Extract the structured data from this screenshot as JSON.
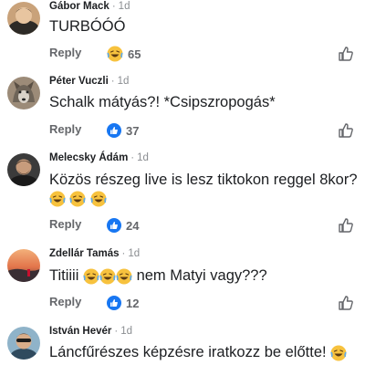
{
  "comments": [
    {
      "name": "Gábor Mack",
      "time": "1d",
      "text": "TURBÓÓÓ",
      "reply": "Reply",
      "reaction": "haha-emoji",
      "count": "65"
    },
    {
      "name": "Péter Vuczli",
      "time": "1d",
      "text": "Schalk mátyás?! *Csipszropogás*",
      "reply": "Reply",
      "reaction": "like-icon",
      "count": "37"
    },
    {
      "name": "Melecsky Ádám",
      "time": "1d",
      "text": "Közös részeg live is lesz tiktokon reggel 8kor?",
      "reply": "Reply",
      "reaction": "like-icon",
      "count": "24"
    },
    {
      "name": "Zdellár Tamás",
      "time": "1d",
      "text_start": "Titiiii",
      "text_end": "nem Matyi vagy???",
      "reply": "Reply",
      "reaction": "like-icon",
      "count": "12"
    },
    {
      "name": "István Hevér",
      "time": "1d",
      "text": "Láncfűrészes képzésre iratkozz be előtte!"
    }
  ],
  "colors": {
    "secondary": "#65676b",
    "accent": "#1877f2",
    "emoji": "#f7c23e"
  }
}
